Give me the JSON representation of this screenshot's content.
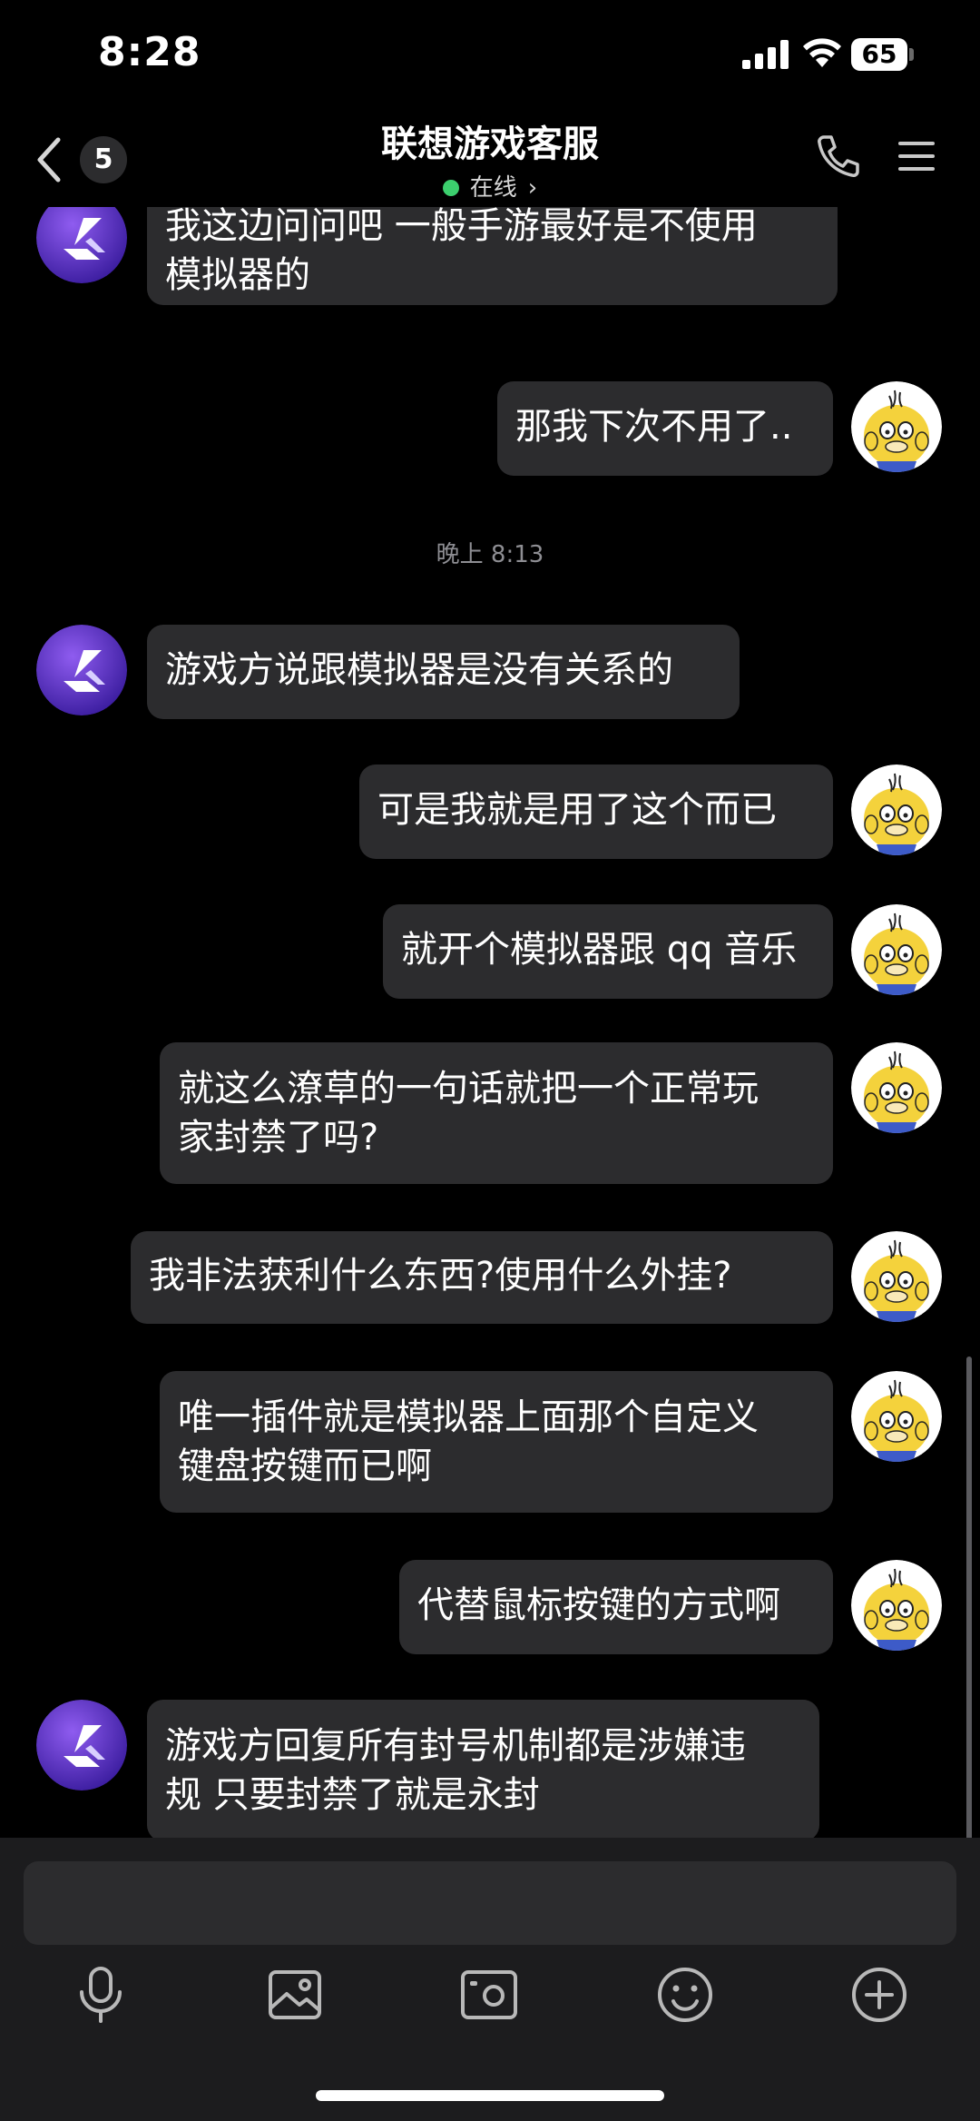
{
  "status_bar": {
    "time": "8:28",
    "battery": "65"
  },
  "header": {
    "unread_count": "5",
    "title": "联想游戏客服",
    "status": "在线"
  },
  "chat": {
    "messages": [
      {
        "from": "agent",
        "lines": [
          "我这边问问吧  一般手游最好是不使用",
          "模拟器的"
        ]
      },
      {
        "from": "user",
        "lines": [
          "那我下次不用了.."
        ]
      },
      {
        "type": "time",
        "text": "晚上 8:13"
      },
      {
        "from": "agent",
        "lines": [
          "游戏方说跟模拟器是没有关系的"
        ]
      },
      {
        "from": "user",
        "lines": [
          "可是我就是用了这个而已"
        ]
      },
      {
        "from": "user",
        "lines": [
          "就开个模拟器跟 qq 音乐"
        ]
      },
      {
        "from": "user",
        "lines": [
          "就这么潦草的一句话就把一个正常玩",
          "家封禁了吗?"
        ]
      },
      {
        "from": "user",
        "lines": [
          "我非法获利什么东西?使用什么外挂?"
        ]
      },
      {
        "from": "user",
        "lines": [
          "唯一插件就是模拟器上面那个自定义",
          "键盘按键而已啊"
        ]
      },
      {
        "from": "user",
        "lines": [
          "代替鼠标按键的方式啊"
        ]
      },
      {
        "from": "agent",
        "lines": [
          "游戏方回复所有封号机制都是涉嫌违",
          "规 只要封禁了就是永封"
        ]
      }
    ]
  },
  "input": {
    "placeholder": ""
  },
  "toolbar": {
    "icons": [
      "microphone-icon",
      "image-icon",
      "camera-icon",
      "emoji-icon",
      "plus-icon"
    ]
  },
  "colors": {
    "background": "#000000",
    "bubble": "#2c2c2e",
    "online": "#3ccf6e",
    "input_bar": "#1c1c1e"
  }
}
